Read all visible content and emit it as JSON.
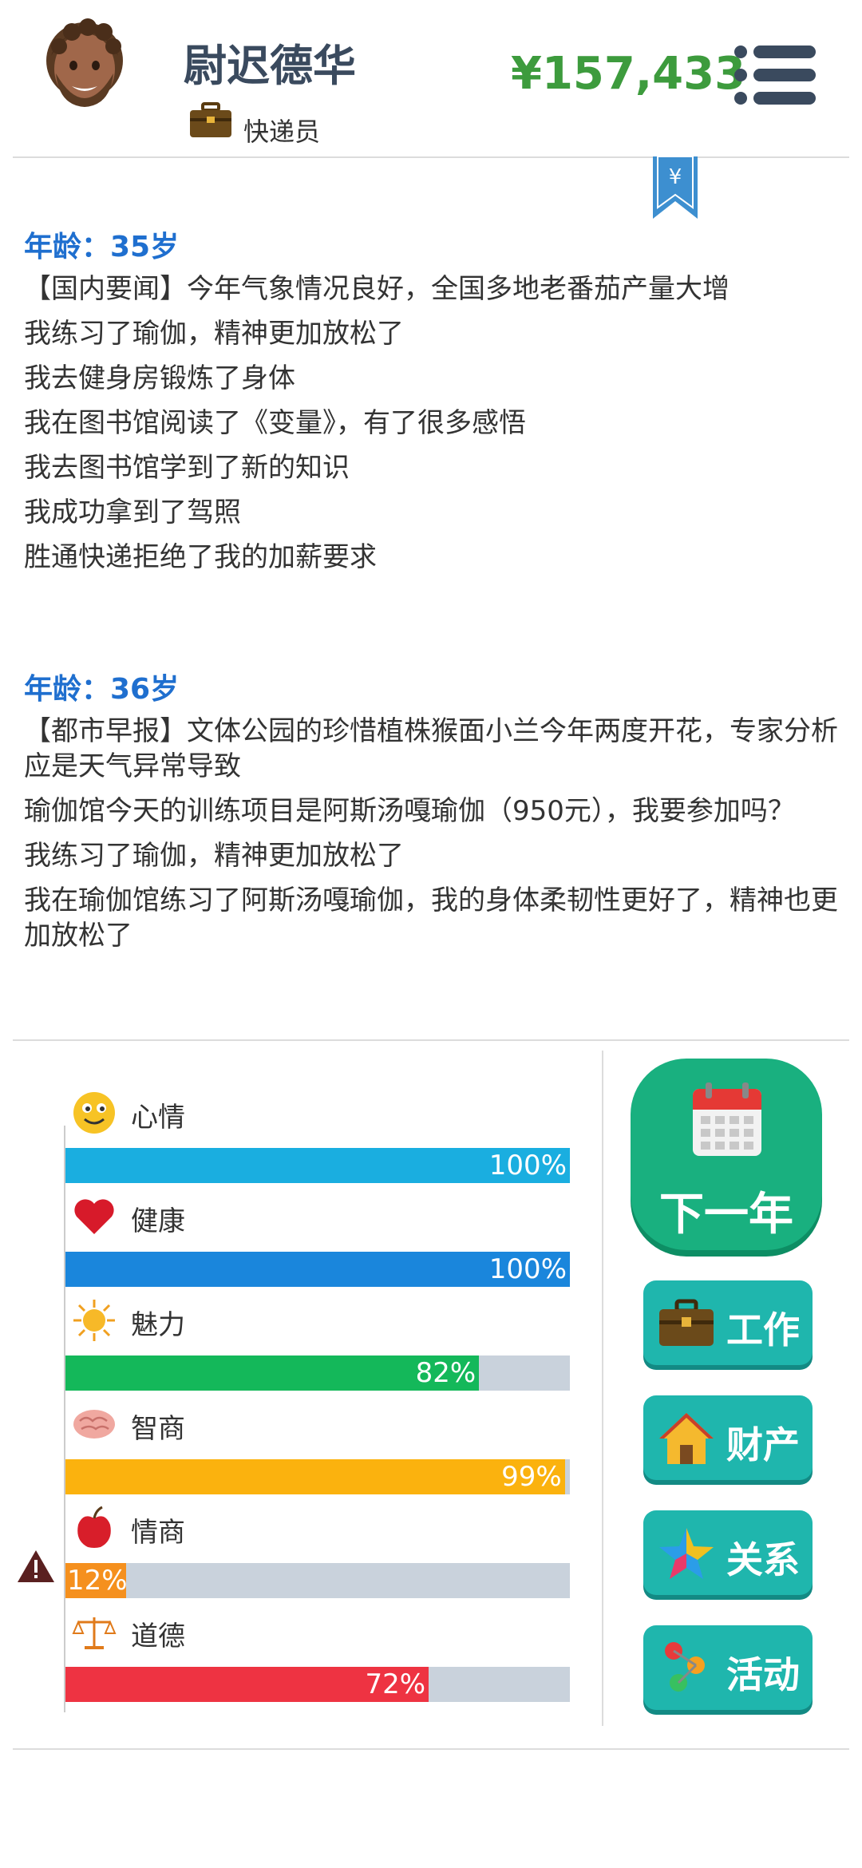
{
  "header": {
    "name": "尉迟德华",
    "job": "快递员",
    "money": "¥157,433"
  },
  "log": [
    {
      "age": "年龄：35岁",
      "lines": [
        "【国内要闻】今年气象情况良好，全国多地老番茄产量大增",
        "我练习了瑜伽，精神更加放松了",
        "我去健身房锻炼了身体",
        "我在图书馆阅读了《变量》，有了很多感悟",
        "我去图书馆学到了新的知识",
        "我成功拿到了驾照",
        "胜通快递拒绝了我的加薪要求"
      ]
    },
    {
      "age": "年龄：36岁",
      "lines": [
        "【都市早报】文体公园的珍惜植株猴面小兰今年两度开花，专家分析应是天气异常导致",
        "瑜伽馆今天的训练项目是阿斯汤嘎瑜伽（950元），我要参加吗？",
        "我练习了瑜伽，精神更加放松了",
        "我在瑜伽馆练习了阿斯汤嘎瑜伽，我的身体柔韧性更好了，精神也更加放松了"
      ]
    }
  ],
  "stats": [
    {
      "label": "心情",
      "pct": "100%",
      "value": 100,
      "color": "#1aaee0",
      "icon": "smiley-icon"
    },
    {
      "label": "健康",
      "pct": "100%",
      "value": 100,
      "color": "#1a86dc",
      "icon": "heart-icon"
    },
    {
      "label": "魅力",
      "pct": "82%",
      "value": 82,
      "color": "#14b85a",
      "icon": "sun-icon"
    },
    {
      "label": "智商",
      "pct": "99%",
      "value": 99,
      "color": "#fbb20e",
      "icon": "brain-icon"
    },
    {
      "label": "情商",
      "pct": "12%",
      "value": 12,
      "color": "#f5901e",
      "icon": "apple-icon"
    },
    {
      "label": "道德",
      "pct": "72%",
      "value": 72,
      "color": "#ee3342",
      "icon": "scales-icon"
    }
  ],
  "buttons": {
    "next_year": "下一年",
    "work": "工作",
    "property": "财产",
    "relations": "关系",
    "activity": "活动"
  }
}
